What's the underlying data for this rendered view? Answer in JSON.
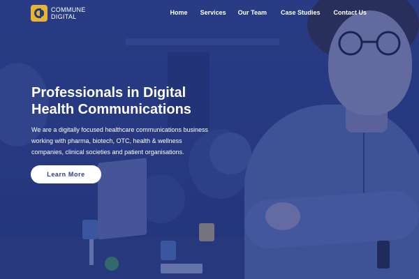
{
  "brand": {
    "line1": "COMMUNE",
    "line2": "DIGITAL",
    "logo_icon": "commune-digital-logo-icon",
    "logo_color": "#e9b42f"
  },
  "nav": {
    "items": [
      {
        "label": "Home"
      },
      {
        "label": "Services"
      },
      {
        "label": "Our Team"
      },
      {
        "label": "Case Studies"
      },
      {
        "label": "Contact Us"
      }
    ]
  },
  "hero": {
    "headline_line1": "Professionals in Digital",
    "headline_line2": "Health Communications",
    "description_line1": "We are a digitally focused healthcare communications business",
    "description_line2": "working with pharma, biotech, OTC, health & wellness",
    "description_line3": "companies, clinical societies and patient organisations.",
    "cta_label": "Learn More"
  },
  "colors": {
    "overlay": "#2a3d8a",
    "accent": "#e9b42f",
    "text": "#ffffff"
  }
}
